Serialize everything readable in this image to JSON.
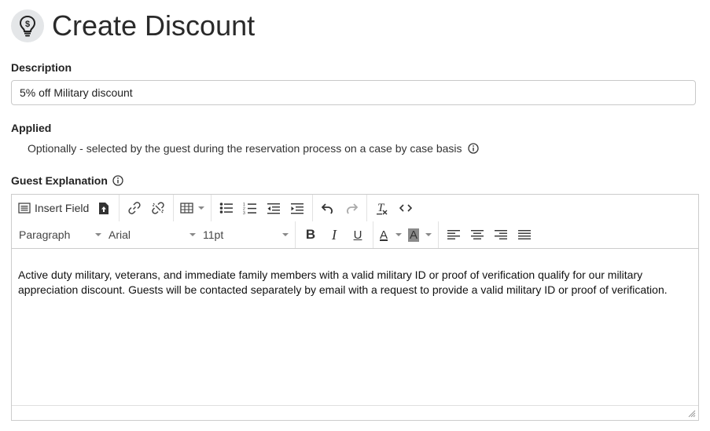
{
  "header": {
    "title": "Create Discount",
    "icon": "lightbulb-dollar-icon"
  },
  "description": {
    "label": "Description",
    "value": "5% off Military discount"
  },
  "applied": {
    "label": "Applied",
    "text": "Optionally - selected by the guest during the reservation process on a case by case basis"
  },
  "guest_explanation": {
    "label": "Guest Explanation",
    "toolbar": {
      "insert_field_label": "Insert Field",
      "block_format": "Paragraph",
      "font_family": "Arial",
      "font_size": "11pt",
      "bold_glyph": "B",
      "italic_glyph": "I",
      "underline_glyph": "U",
      "text_color_glyph": "A",
      "bg_color_glyph": "A"
    },
    "content": "Active duty military, veterans, and immediate family members with a valid military ID or proof of verification qualify for our military appreciation discount. Guests will be contacted separately by email with a request to provide a valid military ID or proof of verification."
  },
  "colors": {
    "border": "#cccccc",
    "icon_bg": "#e4e6e8",
    "text": "#222222"
  }
}
